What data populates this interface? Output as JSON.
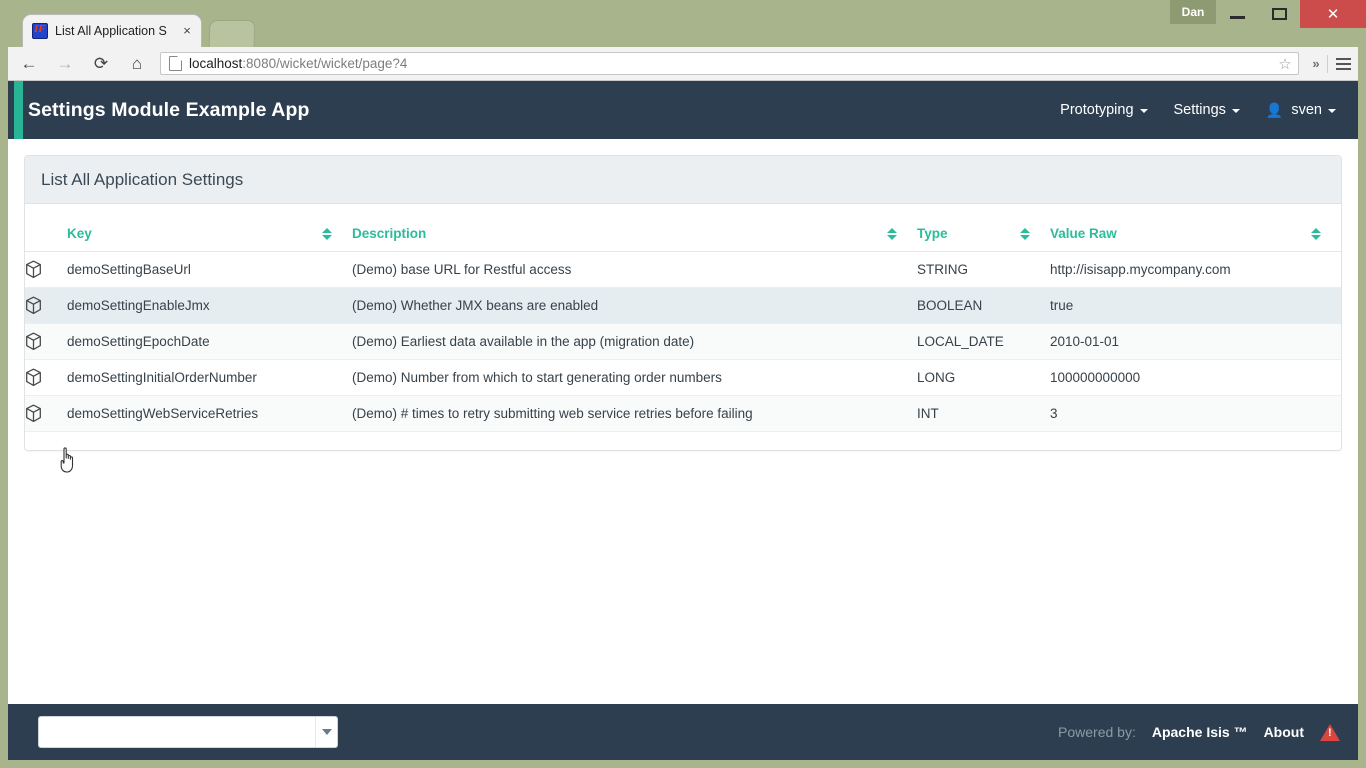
{
  "window": {
    "user_badge": "Dan",
    "minimize_label": "Minimize",
    "maximize_label": "Maximize",
    "close_label": "Close"
  },
  "browser": {
    "tab_title": "List All Application S",
    "tab_favicon": "isis-favicon",
    "tab_close": "×",
    "back_icon": "←",
    "forward_icon": "→",
    "reload_icon": "⟳",
    "home_icon": "⌂",
    "url_host": "localhost",
    "url_rest": ":8080/wicket/wicket/page?4",
    "url_full": "localhost:8080/wicket/wicket/page?4",
    "bookmark_icon": "☆",
    "overflow_icon": "»",
    "menu_icon": "hamburger-menu"
  },
  "navbar": {
    "brand": "Settings Module Example App",
    "accent_color": "#28b595",
    "background_color": "#2c3e50",
    "items": [
      {
        "label": "Prototyping",
        "has_caret": true
      },
      {
        "label": "Settings",
        "has_caret": true
      },
      {
        "label": "sven",
        "has_caret": true,
        "icon": "user-icon"
      }
    ]
  },
  "panel": {
    "title": "List All Application Settings"
  },
  "table": {
    "columns": [
      {
        "key": "icon",
        "label": "",
        "sortable": false
      },
      {
        "key": "key",
        "label": "Key",
        "sortable": true
      },
      {
        "key": "description",
        "label": "Description",
        "sortable": true
      },
      {
        "key": "type",
        "label": "Type",
        "sortable": true
      },
      {
        "key": "value_raw",
        "label": "Value Raw",
        "sortable": true
      }
    ],
    "header_color": "#2bbd9b",
    "rows": [
      {
        "icon": "cube-icon",
        "key": "demoSettingBaseUrl",
        "description": "(Demo) base URL for Restful access",
        "type": "STRING",
        "value_raw": "http://isisapp.mycompany.com",
        "state": "odd"
      },
      {
        "icon": "cube-icon",
        "key": "demoSettingEnableJmx",
        "description": "(Demo) Whether JMX beans are enabled",
        "type": "BOOLEAN",
        "value_raw": "true",
        "state": "hover"
      },
      {
        "icon": "cube-icon",
        "key": "demoSettingEpochDate",
        "description": "(Demo) Earliest data available in the app (migration date)",
        "type": "LOCAL_DATE",
        "value_raw": "2010-01-01",
        "state": "even"
      },
      {
        "icon": "cube-icon",
        "key": "demoSettingInitialOrderNumber",
        "description": "(Demo) Number from which to start generating order numbers",
        "type": "LONG",
        "value_raw": "100000000000",
        "state": "odd"
      },
      {
        "icon": "cube-icon",
        "key": "demoSettingWebServiceRetries",
        "description": "(Demo) # times to retry submitting web service retries before failing",
        "type": "INT",
        "value_raw": "3",
        "state": "even"
      }
    ]
  },
  "footer": {
    "select_value": "",
    "select_placeholder": "",
    "powered_by_label": "Powered by:",
    "product_label": "Apache Isis ™",
    "about_label": "About",
    "warning_icon": "warning-triangle-icon"
  }
}
